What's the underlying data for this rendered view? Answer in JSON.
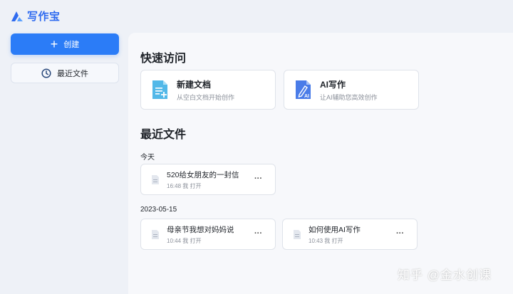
{
  "app": {
    "title": "写作宝"
  },
  "sidebar": {
    "create_label": "创建",
    "recent_label": "最近文件"
  },
  "quick_access": {
    "title": "快速访问",
    "cards": [
      {
        "title": "新建文档",
        "subtitle": "从空白文档开始创作"
      },
      {
        "title": "AI写作",
        "subtitle": "让AI辅助您高效创作"
      }
    ]
  },
  "recent": {
    "title": "最近文件",
    "groups": [
      {
        "label": "今天",
        "files": [
          {
            "name": "520给女朋友的一封信",
            "meta": "16:48 我 打开"
          }
        ]
      },
      {
        "label": "2023-05-15",
        "files": [
          {
            "name": "母亲节我想对妈妈说",
            "meta": "10:44 我 打开"
          },
          {
            "name": "如何使用AI写作",
            "meta": "10:43 我 打开"
          }
        ]
      }
    ],
    "more_label": "···"
  },
  "watermark": "知乎 @金水创课",
  "colors": {
    "accent": "#2b7cf7",
    "background": "#eef1f7"
  }
}
